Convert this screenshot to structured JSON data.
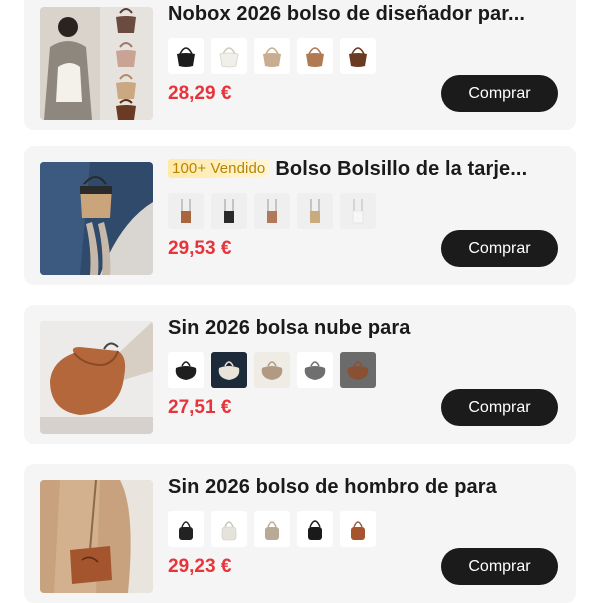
{
  "products": [
    {
      "title": "Nobox 2026 bolso de diseñador par...",
      "badge": "",
      "price": "28,29 €",
      "buy_label": "Comprar",
      "variant_colors": [
        "#1c1c1c",
        "#f1efe9",
        "#c9ad90",
        "#b07a52",
        "#6b3a22"
      ]
    },
    {
      "title": "Bolso Bolsillo de la tarje...",
      "badge": "100+ Vendido",
      "price": "29,53 €",
      "buy_label": "Comprar",
      "variant_colors": [
        "#a9653e",
        "#2a2a2a",
        "#b07a5a",
        "#c9ab7e",
        "#ececec"
      ]
    },
    {
      "title": "Sin 2026 bolsa nube para",
      "badge": "",
      "price": "27,51 €",
      "buy_label": "Comprar",
      "variant_colors": [
        "#1e1e1e",
        "#e8e4da",
        "#b29a82",
        "#6f6f6f",
        "#8a5034"
      ]
    },
    {
      "title": "Sin 2026 bolso de hombro de para",
      "badge": "",
      "price": "29,23 €",
      "buy_label": "Comprar",
      "variant_colors": [
        "#222222",
        "#e6e2dc",
        "#b9a997",
        "#1a1a1a",
        "#a4552e"
      ]
    }
  ]
}
